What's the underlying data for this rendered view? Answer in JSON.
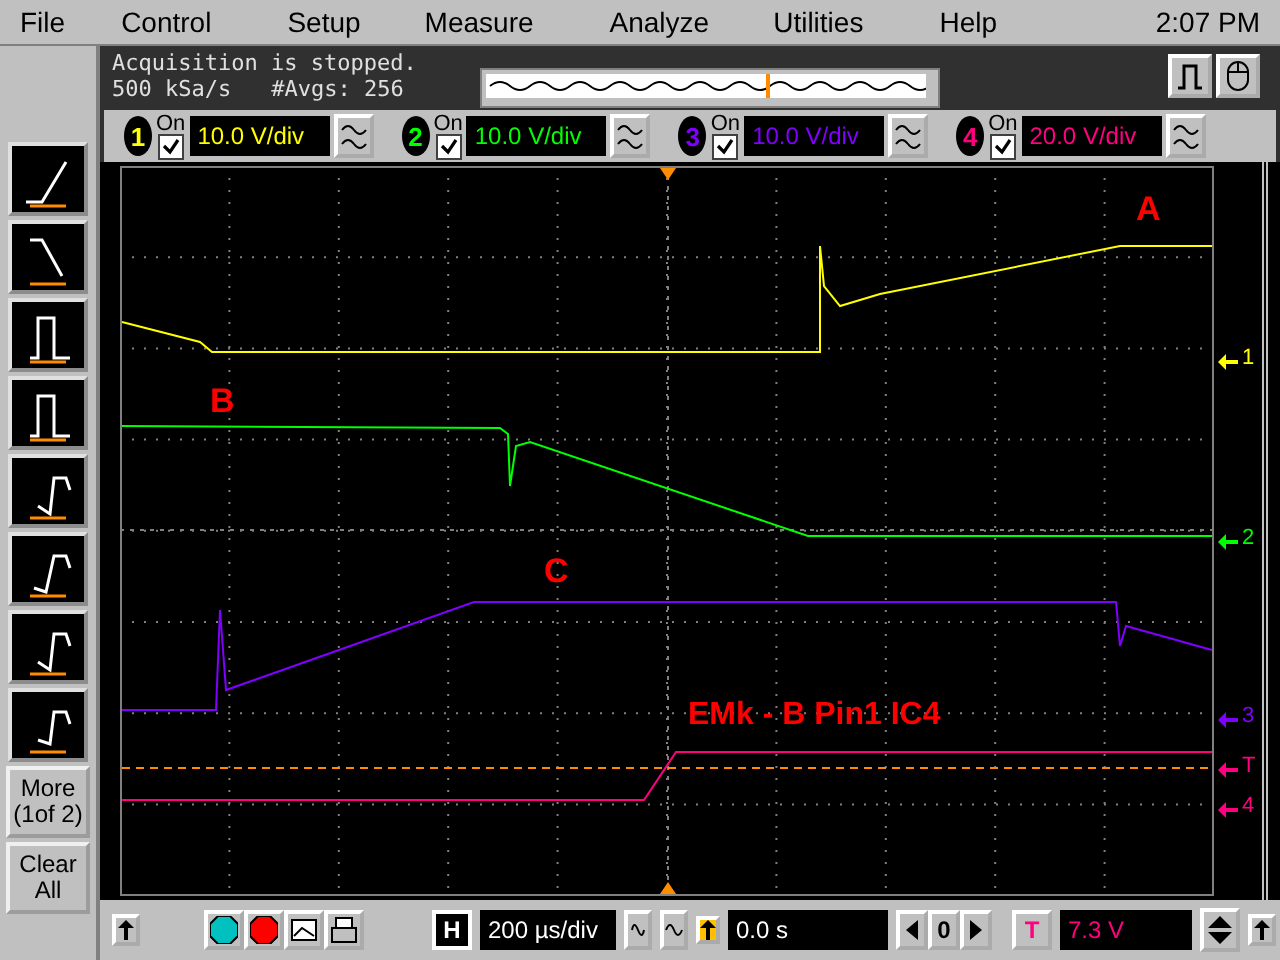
{
  "menu": [
    "File",
    "Control",
    "Setup",
    "Measure",
    "Analyze",
    "Utilities",
    "Help"
  ],
  "clock": "2:07 PM",
  "status": {
    "message": "Acquisition is stopped.",
    "sample_rate": "500 kSa/s",
    "averages": "#Avgs: 256"
  },
  "channels": [
    {
      "number": "1",
      "on_label": "On",
      "on": true,
      "scale": "10.0 V/div",
      "color": "#ffff00"
    },
    {
      "number": "2",
      "on_label": "On",
      "on": true,
      "scale": "10.0 V/div",
      "color": "#00ff00"
    },
    {
      "number": "3",
      "on_label": "On",
      "on": true,
      "scale": "10.0 V/div",
      "color": "#8000ff"
    },
    {
      "number": "4",
      "on_label": "On",
      "on": true,
      "scale": "20.0 V/div",
      "color": "#ff0080"
    }
  ],
  "side_buttons": [
    {
      "line1": "More",
      "line2": "(1of 2)"
    },
    {
      "line1": "Clear",
      "line2": "All"
    }
  ],
  "annotations": [
    {
      "label": "A"
    },
    {
      "label": "B"
    },
    {
      "label": "C"
    },
    {
      "label": "EMk - B Pin1 IC4"
    }
  ],
  "markers": [
    {
      "label": "1"
    },
    {
      "label": "2"
    },
    {
      "label": "3"
    },
    {
      "label": "T"
    },
    {
      "label": "4"
    }
  ],
  "horizontal": {
    "button": "H",
    "scale": "200 µs/div",
    "delay": "0.0 s",
    "center_button": "0"
  },
  "trigger": {
    "button": "T",
    "level": "7.3 V"
  }
}
